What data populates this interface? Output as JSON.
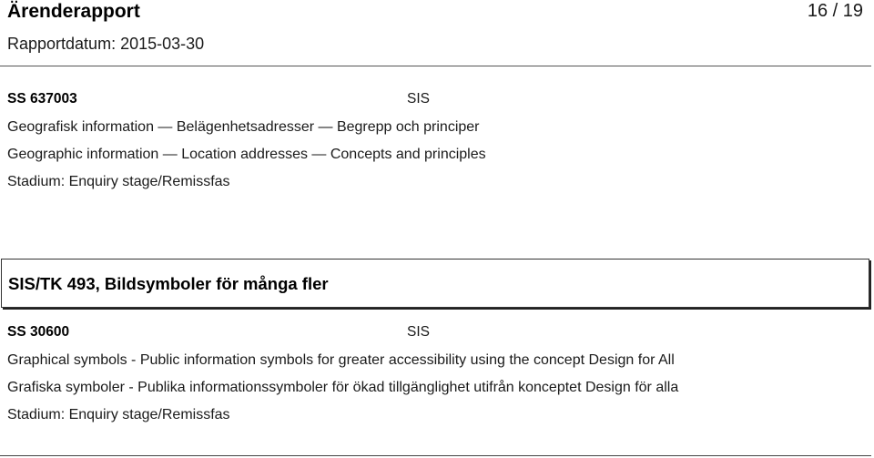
{
  "header": {
    "title": "Ärenderapport",
    "page_number": "16 / 19",
    "report_date": "Rapportdatum: 2015-03-30"
  },
  "standards": [
    {
      "code": "SS 637003",
      "organization": "SIS",
      "title_sv": "Geografisk information — Belägenhetsadresser — Begrepp och principer",
      "title_en": "Geographic information — Location addresses — Concepts and principles",
      "stage": "Stadium: Enquiry stage/Remissfas"
    },
    {
      "code": "SS 30600",
      "organization": "SIS",
      "title_en": "Graphical symbols - Public information symbols for greater accessibility using the concept Design for All",
      "title_sv": "Grafiska symboler - Publika informationssymboler för ökad tillgänglighet utifrån konceptet Design för alla",
      "stage": "Stadium: Enquiry stage/Remissfas"
    }
  ],
  "committee": {
    "title": "SIS/TK 493, Bildsymboler för många fler"
  }
}
